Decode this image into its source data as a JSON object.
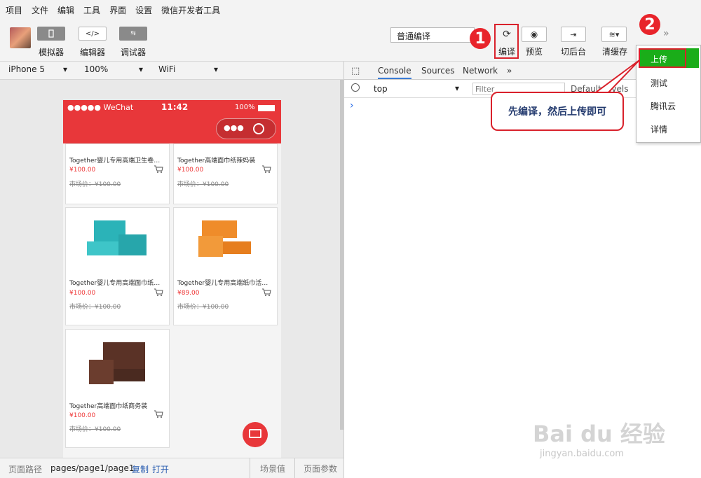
{
  "menu": [
    "项目",
    "文件",
    "编辑",
    "工具",
    "界面",
    "设置",
    "微信开发者工具"
  ],
  "toolbar": {
    "simulator": "模拟器",
    "editor": "编辑器",
    "debugger": "调试器",
    "compile_mode": "普通编译",
    "compile": "编译",
    "preview": "预览",
    "background": "切后台",
    "clear_cache": "清缓存"
  },
  "device_bar": {
    "device": "iPhone 5",
    "zoom": "100%",
    "network": "WiFi"
  },
  "phone": {
    "carrier": "●●●●● WeChat",
    "time": "11:42",
    "battery": "100%",
    "products": [
      {
        "title": "Together婴儿专用高端卫生卷…",
        "price": "¥100.00",
        "market": "市场价：¥100.00"
      },
      {
        "title": "Together高端面巾纸辣妈装",
        "price": "¥100.00",
        "market": "市场价：¥100.00"
      },
      {
        "title": "Together婴儿专用高端面巾纸…",
        "price": "¥100.00",
        "market": "市场价：¥100.00"
      },
      {
        "title": "Together婴儿专用高端纸巾活…",
        "price": "¥89.00",
        "market": "市场价：¥100.00"
      },
      {
        "title": "Together高端面巾纸商务装",
        "price": "¥100.00",
        "market": "市场价：¥100.00"
      }
    ]
  },
  "status": {
    "path_label": "页面路径",
    "path": "pages/page1/page1",
    "copy": "复制",
    "open": "打开",
    "scene": "场景值",
    "params": "页面参数"
  },
  "devtools": {
    "tabs": [
      "Console",
      "Sources",
      "Network"
    ],
    "more": "»",
    "context": "top",
    "filter_placeholder": "Filter",
    "levels": "Default levels",
    "prompt": "›"
  },
  "dropdown": [
    "上传",
    "测试",
    "腾讯云",
    "详情"
  ],
  "annotations": {
    "step1": "1",
    "step2": "2",
    "callout": "先编译，然后上传即可"
  },
  "watermark": {
    "brand": "Bai du 经验",
    "url": "jingyan.baidu.com"
  },
  "colors": {
    "red": "#e8373a",
    "green": "#1aad19",
    "annot": "#d9212b"
  }
}
